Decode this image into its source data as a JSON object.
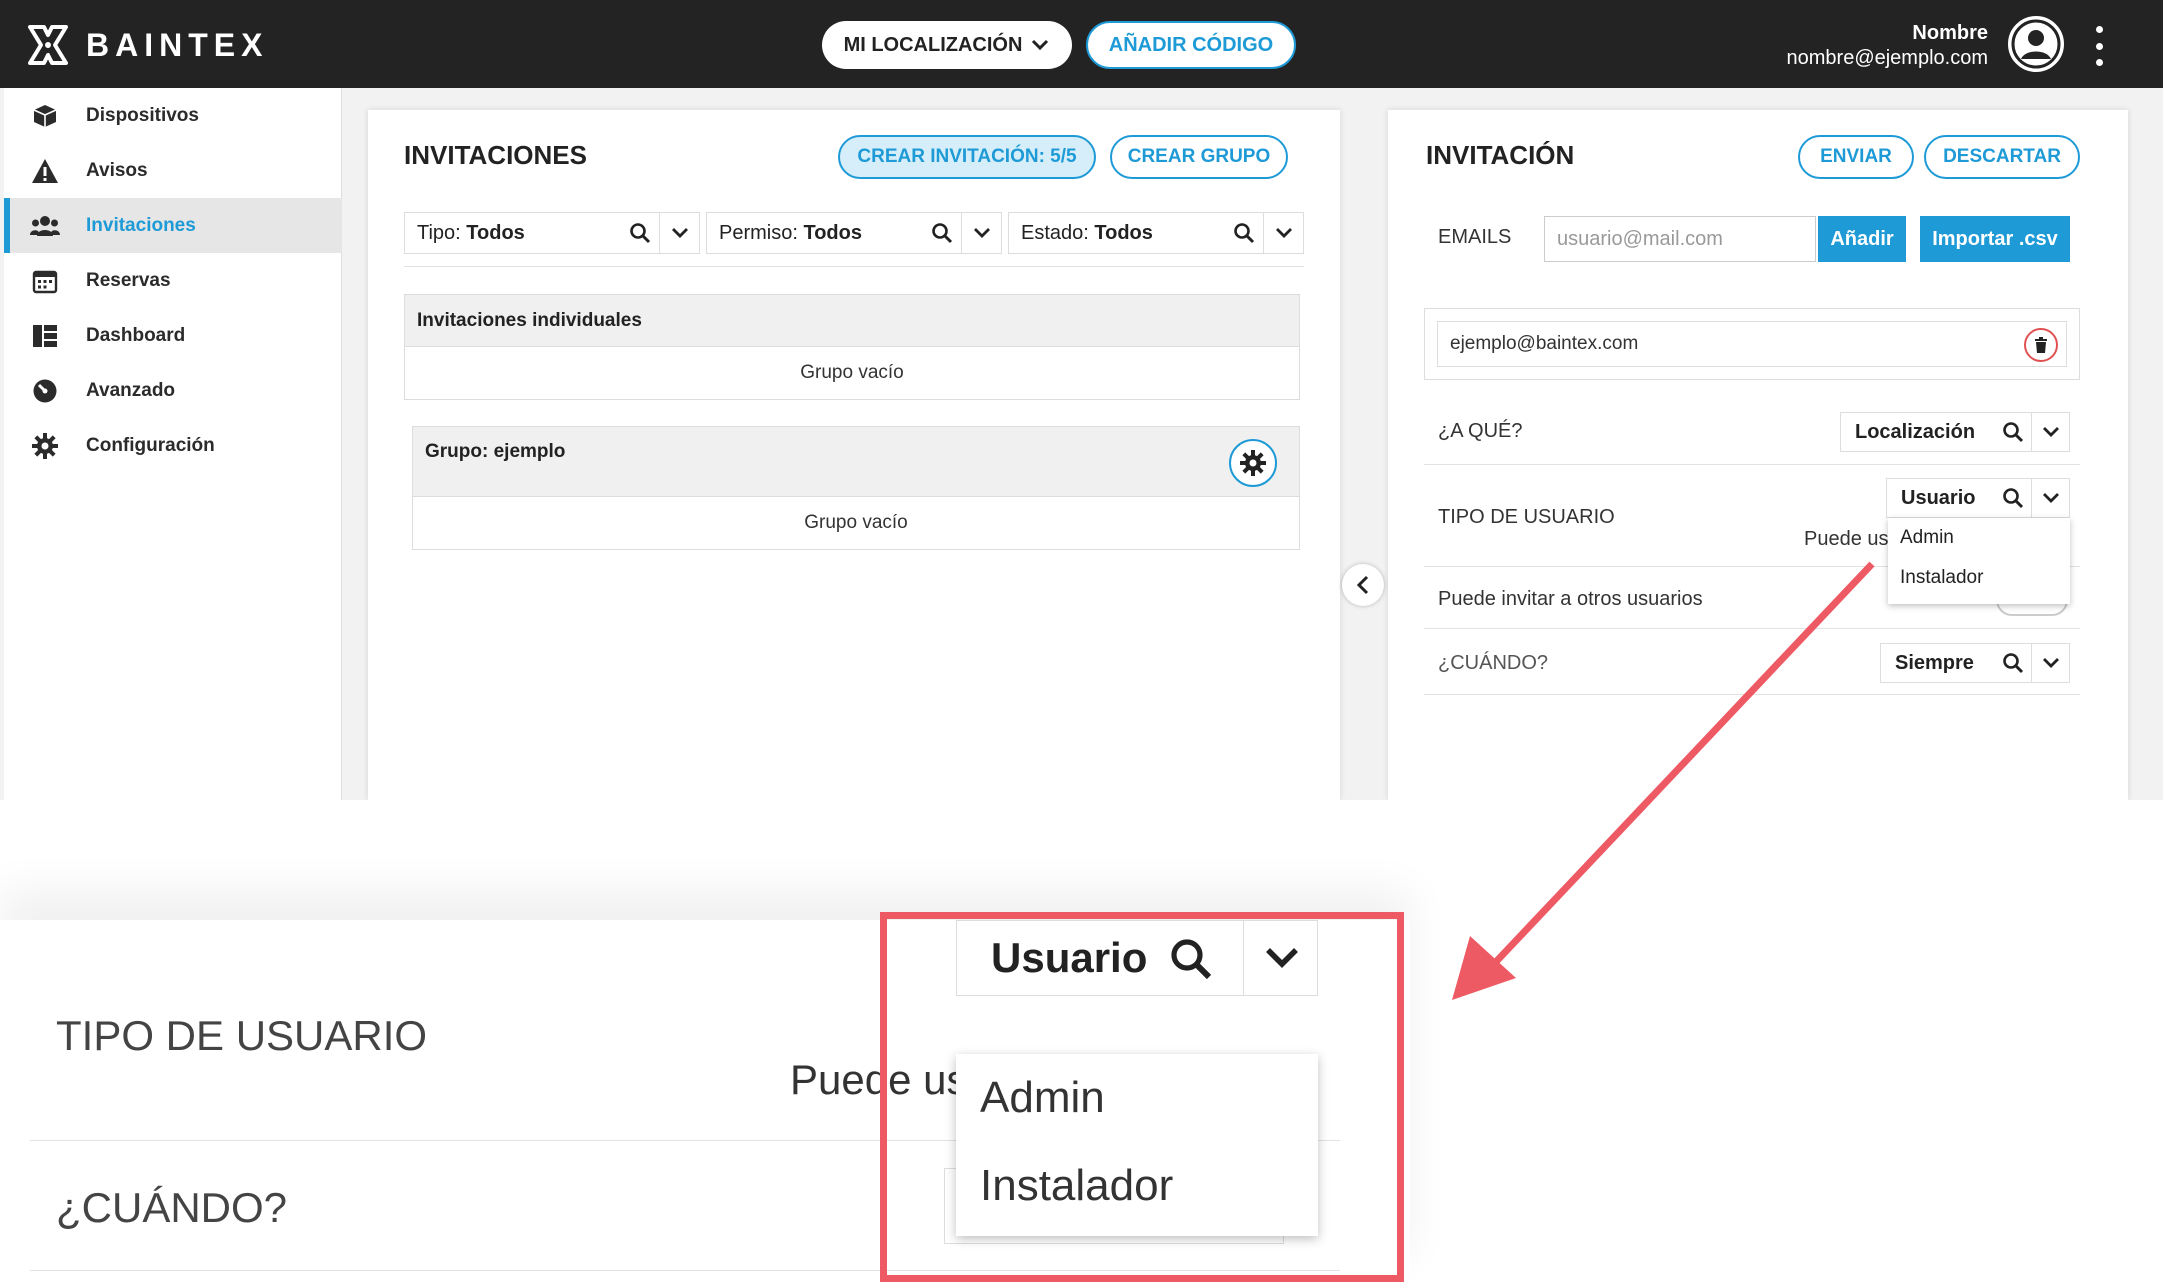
{
  "brand": "BAINTEX",
  "topbar": {
    "location_label": "MI LOCALIZACIÓN",
    "add_code_label": "AÑADIR CÓDIGO",
    "user_name": "Nombre",
    "user_email": "nombre@ejemplo.com"
  },
  "sidebar": {
    "items": [
      {
        "label": "Dispositivos",
        "icon": "cube-icon"
      },
      {
        "label": "Avisos",
        "icon": "warning-icon"
      },
      {
        "label": "Invitaciones",
        "icon": "users-icon",
        "active": true
      },
      {
        "label": "Reservas",
        "icon": "calendar-icon"
      },
      {
        "label": "Dashboard",
        "icon": "dashboard-icon"
      },
      {
        "label": "Avanzado",
        "icon": "gauge-icon"
      },
      {
        "label": "Configuración",
        "icon": "gear-icon"
      }
    ]
  },
  "invitations": {
    "title": "INVITACIONES",
    "create_invitation_label": "CREAR INVITACIÓN: 5/5",
    "create_group_label": "CREAR GRUPO",
    "filters": [
      {
        "prefix": "Tipo: ",
        "value": "Todos"
      },
      {
        "prefix": "Permiso: ",
        "value": "Todos"
      },
      {
        "prefix": "Estado: ",
        "value": "Todos"
      }
    ],
    "individual_group": {
      "title": "Invitaciones individuales",
      "empty": "Grupo vacío"
    },
    "named_group": {
      "title": "Grupo: ejemplo",
      "empty": "Grupo vacío"
    }
  },
  "detail": {
    "title": "INVITACIÓN",
    "send_label": "ENVIAR",
    "discard_label": "DESCARTAR",
    "emails_label": "EMAILS",
    "email_placeholder": "usuario@mail.com",
    "add_label": "Añadir",
    "import_label": "Importar .csv",
    "email_chip": "ejemplo@baintex.com",
    "what_label": "¿A QUÉ?",
    "what_value": "Localización",
    "user_type_label": "TIPO DE USUARIO",
    "user_type_value": "Usuario",
    "user_type_note": "Puede us",
    "user_type_options": [
      "Admin",
      "Instalador"
    ],
    "invite_others_label": "Puede invitar a otros usuarios",
    "when_label": "¿CUÁNDO?",
    "when_value": "Siempre"
  },
  "zoom": {
    "user_type_label": "TIPO DE USUARIO",
    "user_type_value": "Usuario",
    "user_type_note": "Puede us",
    "options": [
      "Admin",
      "Instalador"
    ],
    "when_label": "¿CUÁNDO?"
  },
  "colors": {
    "accent": "#1e9ad6",
    "topbar": "#232323",
    "highlight": "#ee5a64",
    "danger": "#e05252"
  }
}
